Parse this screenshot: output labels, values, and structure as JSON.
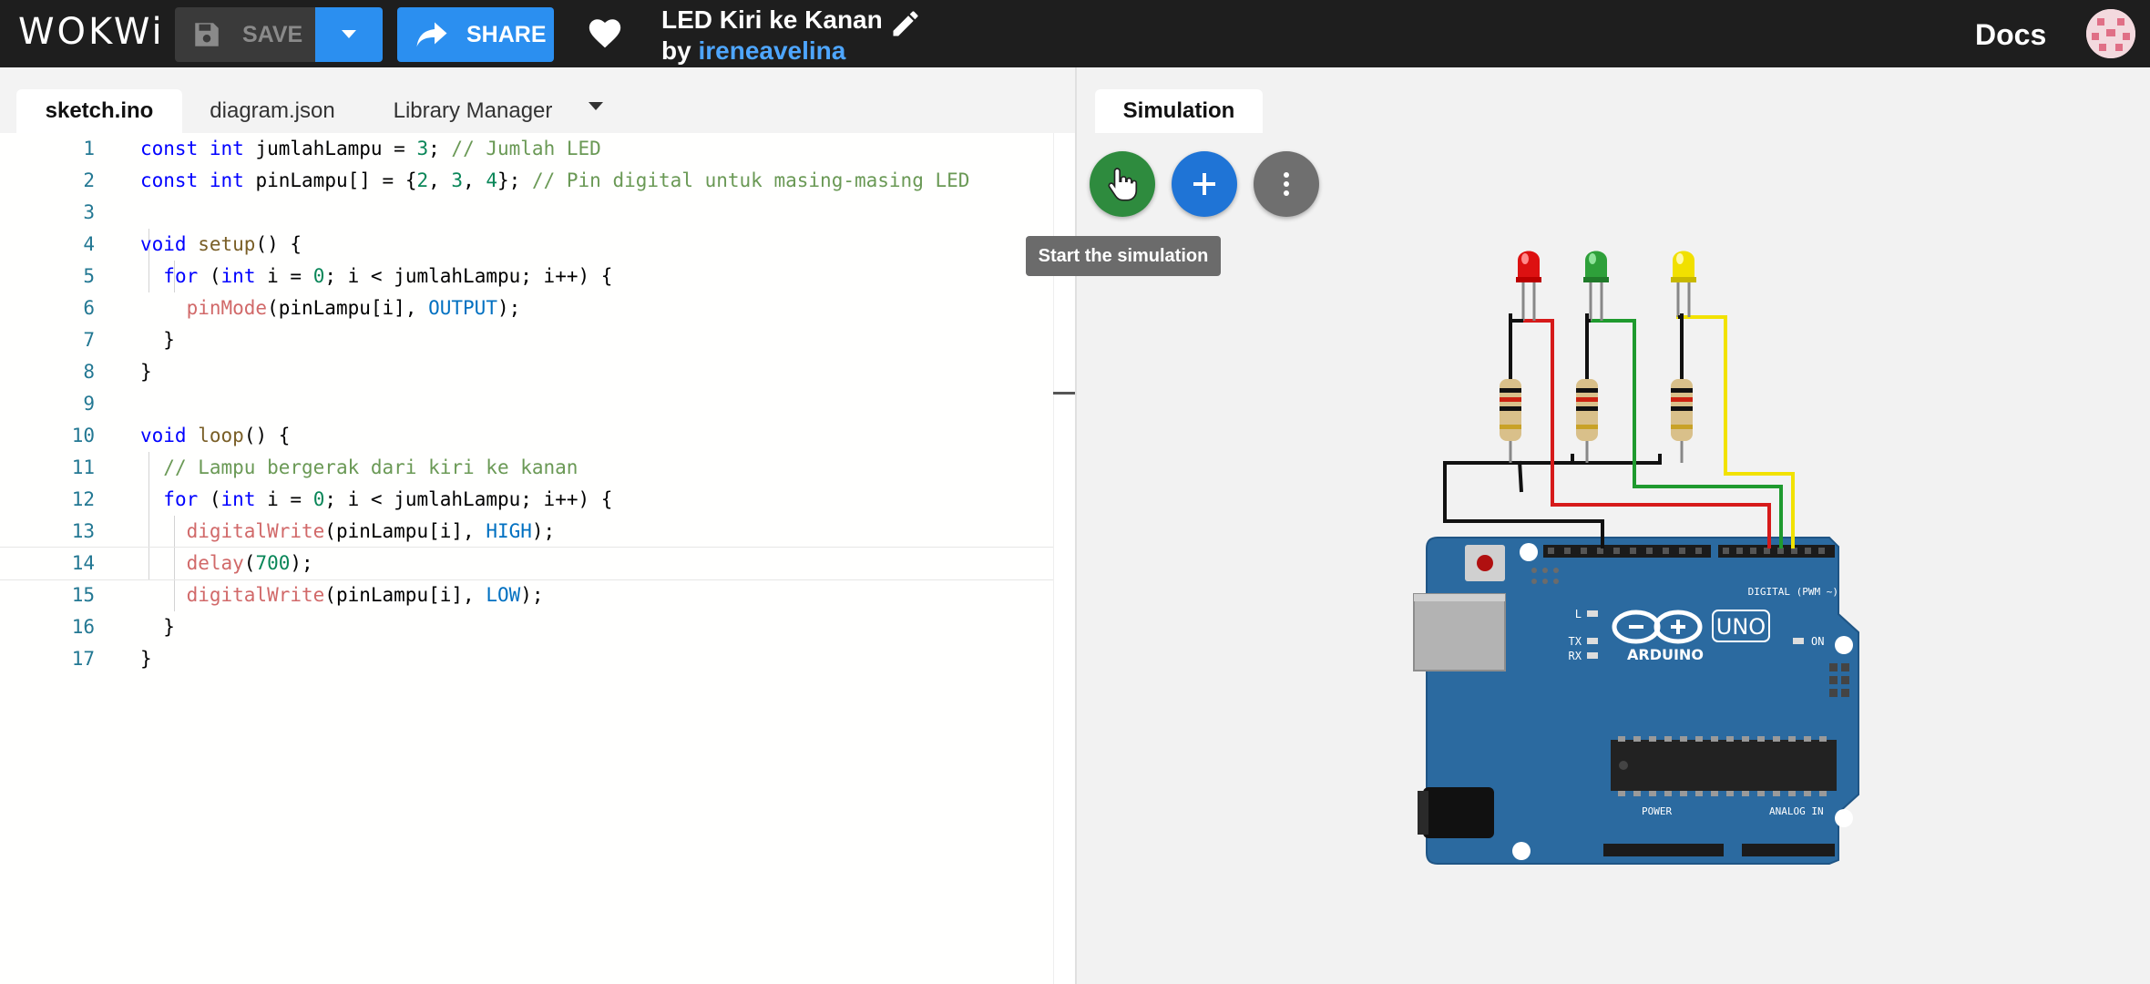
{
  "header": {
    "logo": "WOKWi",
    "save_label": "SAVE",
    "share_label": "SHARE",
    "project_title": "LED Kiri ke Kanan",
    "by_label": "by",
    "author": "ireneavelina",
    "docs_label": "Docs"
  },
  "editor": {
    "tabs": [
      {
        "label": "sketch.ino",
        "active": true
      },
      {
        "label": "diagram.json",
        "active": false
      },
      {
        "label": "Library Manager",
        "active": false
      }
    ],
    "current_line": 14,
    "lines": [
      {
        "n": "1",
        "text": "const int jumlahLampu = 3; // Jumlah LED"
      },
      {
        "n": "2",
        "text": "const int pinLampu[] = {2, 3, 4}; // Pin digital untuk masing-masing LED"
      },
      {
        "n": "3",
        "text": ""
      },
      {
        "n": "4",
        "text": "void setup() {"
      },
      {
        "n": "5",
        "text": "  for (int i = 0; i < jumlahLampu; i++) {"
      },
      {
        "n": "6",
        "text": "    pinMode(pinLampu[i], OUTPUT);"
      },
      {
        "n": "7",
        "text": "  }"
      },
      {
        "n": "8",
        "text": "}"
      },
      {
        "n": "9",
        "text": ""
      },
      {
        "n": "10",
        "text": "void loop() {"
      },
      {
        "n": "11",
        "text": "  // Lampu bergerak dari kiri ke kanan"
      },
      {
        "n": "12",
        "text": "  for (int i = 0; i < jumlahLampu; i++) {"
      },
      {
        "n": "13",
        "text": "    digitalWrite(pinLampu[i], HIGH);"
      },
      {
        "n": "14",
        "text": "    delay(700);"
      },
      {
        "n": "15",
        "text": "    digitalWrite(pinLampu[i], LOW);"
      },
      {
        "n": "16",
        "text": "  }"
      },
      {
        "n": "17",
        "text": "}"
      }
    ]
  },
  "simulation": {
    "tab_label": "Simulation",
    "tooltip": "Start the simulation",
    "board": {
      "brand": "ARDUINO",
      "model": "UNO",
      "digital_label": "DIGITAL (PWM ~)",
      "analog_label": "ANALOG IN",
      "power_label": "POWER",
      "on_label": "ON",
      "l_label": "L",
      "tx_label": "TX",
      "rx_label": "RX"
    },
    "leds": [
      "red",
      "green",
      "yellow"
    ]
  },
  "colors": {
    "header_bg": "#1e1e1e",
    "accent_blue": "#2b8ff0",
    "play_green": "#2e8b3e",
    "add_blue": "#1f74d6",
    "menu_gray": "#6f6f6f",
    "board_blue": "#2b6aa0"
  }
}
